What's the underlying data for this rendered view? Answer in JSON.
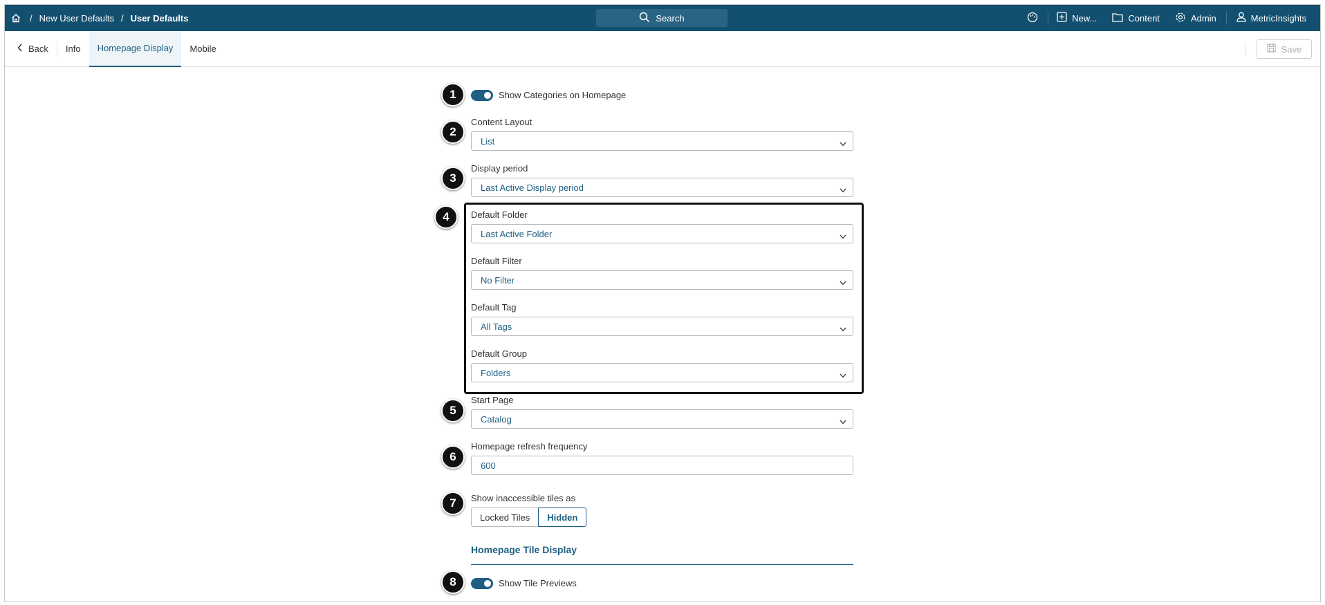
{
  "breadcrumb": {
    "parent": "New User Defaults",
    "current": "User Defaults",
    "separator": "/"
  },
  "search": {
    "label": "Search"
  },
  "topnav": {
    "new_label": "New...",
    "content_label": "Content",
    "admin_label": "Admin",
    "user_label": "MetricInsights"
  },
  "tabs": {
    "back": "Back",
    "info": "Info",
    "homepage_display": "Homepage Display",
    "mobile": "Mobile"
  },
  "toolbar": {
    "save_label": "Save"
  },
  "markers": [
    "1",
    "2",
    "3",
    "4",
    "5",
    "6",
    "7",
    "8"
  ],
  "form": {
    "show_categories_label": "Show Categories on Homepage",
    "show_categories_on": true,
    "content_layout": {
      "label": "Content Layout",
      "value": "List"
    },
    "display_period": {
      "label": "Display period",
      "value": "Last Active Display period"
    },
    "default_folder": {
      "label": "Default Folder",
      "value": "Last Active Folder"
    },
    "default_filter": {
      "label": "Default Filter",
      "value": "No Filter"
    },
    "default_tag": {
      "label": "Default Tag",
      "value": "All Tags"
    },
    "default_group": {
      "label": "Default Group",
      "value": "Folders"
    },
    "start_page": {
      "label": "Start Page",
      "value": "Catalog"
    },
    "refresh_frequency": {
      "label": "Homepage refresh frequency",
      "value": "600"
    },
    "inaccessible_tiles": {
      "label": "Show inaccessible tiles as",
      "options": [
        "Locked Tiles",
        "Hidden"
      ],
      "selected": "Hidden"
    },
    "tile_display_heading": "Homepage Tile Display",
    "show_tile_previews_label": "Show Tile Previews",
    "show_tile_previews_on": true
  },
  "colors": {
    "topbar": "#13506f",
    "accent": "#1d5f82",
    "marker": "#111111"
  }
}
